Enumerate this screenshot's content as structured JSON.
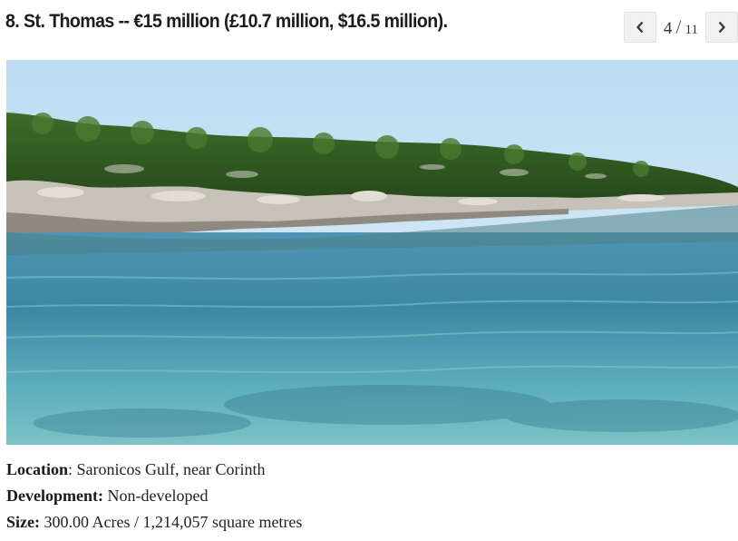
{
  "headline": "8. St. Thomas -- €15 million (£10.7 million, $16.5 million).",
  "pager": {
    "prev_icon": "chevron-left-icon",
    "next_icon": "chevron-right-icon",
    "current": "4",
    "separator": "/",
    "total": "11"
  },
  "photo": {
    "subject": "island coastline with clear turquoise sea",
    "colors": {
      "sky": "#cfe6f5",
      "trees": "#2f5a1f",
      "rocks": "#bdb7ad",
      "water": "#3f8fa6"
    }
  },
  "details": {
    "location_label": "Location",
    "location_value": ": Saronicos Gulf, near Corinth",
    "development_label": "Development:",
    "development_value": " Non-developed",
    "size_label": "Size:",
    "size_value": " 300.00 Acres / 1,214,057 square metres"
  }
}
